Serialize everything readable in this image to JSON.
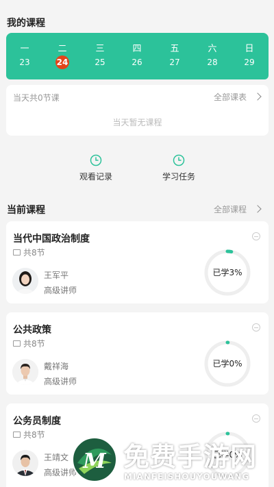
{
  "header": {
    "title": "我的课程"
  },
  "calendar": {
    "accent": "#2cc29a",
    "today_color": "#e4451a",
    "days": [
      {
        "weekday": "一",
        "date": "23"
      },
      {
        "weekday": "二",
        "date": "24",
        "today": true
      },
      {
        "weekday": "三",
        "date": "25"
      },
      {
        "weekday": "四",
        "date": "26"
      },
      {
        "weekday": "五",
        "date": "27"
      },
      {
        "weekday": "六",
        "date": "28"
      },
      {
        "weekday": "日",
        "date": "29"
      }
    ]
  },
  "day_info": {
    "count_text": "当天共0节课",
    "all_schedule": "全部课表",
    "empty_text": "当天暂无课程"
  },
  "quick_actions": [
    {
      "label": "观看记录",
      "icon": "clock-icon"
    },
    {
      "label": "学习任务",
      "icon": "clock-icon"
    }
  ],
  "current": {
    "title": "当前课程",
    "all_courses": "全部课程",
    "courses": [
      {
        "title": "当代中国政治制度",
        "lessons": "共8节",
        "teacher": "王军平",
        "teacher_title": "高级讲师",
        "progress_label": "已学3%",
        "progress": 0.03
      },
      {
        "title": "公共政策",
        "lessons": "共8节",
        "teacher": "戴祥海",
        "teacher_title": "高级讲师",
        "progress_label": "已学0%",
        "progress": 0.0
      },
      {
        "title": "公务员制度",
        "lessons": "共8节",
        "teacher": "王靖文",
        "teacher_title": "高级讲师",
        "progress_label": "已学0%",
        "progress": 0.0
      }
    ]
  },
  "watermark": {
    "text": "免费手游网",
    "sub": "MIANFEISHOUYOUWANG",
    "logo_letter": "M"
  }
}
